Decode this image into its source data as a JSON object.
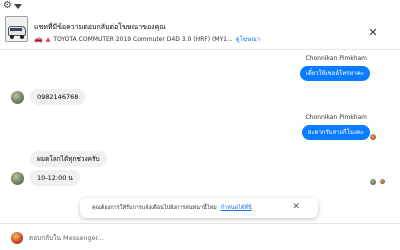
{
  "header": {
    "title": "แชทที่มีข้อความตอบกลับต่อโฆษณาของคุณ",
    "vehicle": "TOYOTA COMMUTER 2019 Commuter D4D 3.0 (HRF) (MY1...",
    "view_link": "ดูโฆษณา"
  },
  "messages": [
    {
      "direction": "out",
      "sender": "",
      "text": "เดี๋ยวให้เซลล์โทรหาคะ"
    },
    {
      "direction": "in",
      "text": "0982146768"
    },
    {
      "direction": "out",
      "sender": "Chonnikan Pimkham",
      "text": "สะดวกรับสายกี่โมงคะ"
    },
    {
      "direction": "in",
      "text": "ผมตโลกได้ทุกช่วงครับ"
    },
    {
      "direction": "in",
      "text": "10-12:00 น"
    }
  ],
  "first_sender": "Chonnikan Pimkham",
  "toast": {
    "text": "คุณต้องการให้รับการแจ้งเตือนไปยังการสนทนานี้ไหม",
    "link": "กำหนดได้ที่นี่",
    "close": "✕"
  },
  "composer": {
    "placeholder": "ตอบกลับใน Messenger..."
  },
  "colors": {
    "accent": "#0a7cff",
    "incoming_bubble": "#f0f0f0",
    "link": "#1a73e8"
  }
}
